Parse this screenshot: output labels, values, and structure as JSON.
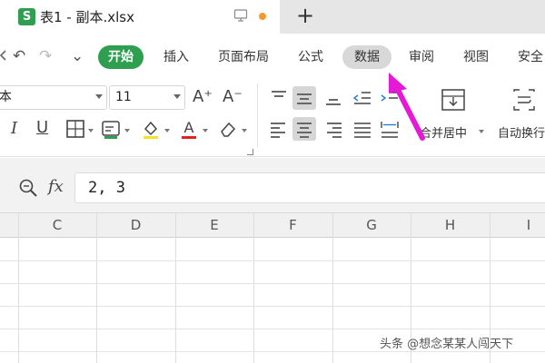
{
  "title_bar": {
    "app_icon_letter": "S",
    "document_name": "表1 - 副本.xlsx",
    "new_tab_symbol": "+"
  },
  "quick_access": {
    "undo_symbol": "↶",
    "redo_symbol": "↷",
    "customize_symbol": "⌄"
  },
  "menu": {
    "items": [
      "开始",
      "插入",
      "页面布局",
      "公式",
      "数据",
      "审阅",
      "视图",
      "安全"
    ],
    "active_index": 0,
    "highlighted_index": 4,
    "active_color": "#2e9e4f"
  },
  "ribbon": {
    "font_name_partial": "本",
    "font_size": "11",
    "grow_font": "A⁺",
    "shrink_font": "A⁻",
    "italic": "I",
    "underline": "U",
    "merge_center_label": "合并居中",
    "auto_wrap_label": "自动换行"
  },
  "formula_bar": {
    "fx_label": "fx",
    "content": "2, 3"
  },
  "grid": {
    "columns": [
      "C",
      "D",
      "E",
      "F",
      "G",
      "H",
      "I"
    ]
  },
  "annotation": {
    "arrow_color": "#e41ad6"
  },
  "watermark": "头条 @想念某某人闯天下"
}
